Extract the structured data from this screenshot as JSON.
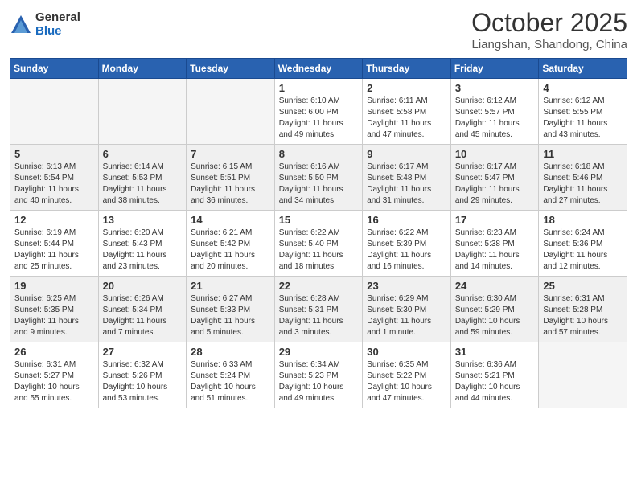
{
  "header": {
    "logo_general": "General",
    "logo_blue": "Blue",
    "month_title": "October 2025",
    "location": "Liangshan, Shandong, China"
  },
  "days_of_week": [
    "Sunday",
    "Monday",
    "Tuesday",
    "Wednesday",
    "Thursday",
    "Friday",
    "Saturday"
  ],
  "weeks": [
    {
      "shade": false,
      "days": [
        {
          "num": "",
          "info": ""
        },
        {
          "num": "",
          "info": ""
        },
        {
          "num": "",
          "info": ""
        },
        {
          "num": "1",
          "info": "Sunrise: 6:10 AM\nSunset: 6:00 PM\nDaylight: 11 hours\nand 49 minutes."
        },
        {
          "num": "2",
          "info": "Sunrise: 6:11 AM\nSunset: 5:58 PM\nDaylight: 11 hours\nand 47 minutes."
        },
        {
          "num": "3",
          "info": "Sunrise: 6:12 AM\nSunset: 5:57 PM\nDaylight: 11 hours\nand 45 minutes."
        },
        {
          "num": "4",
          "info": "Sunrise: 6:12 AM\nSunset: 5:55 PM\nDaylight: 11 hours\nand 43 minutes."
        }
      ]
    },
    {
      "shade": true,
      "days": [
        {
          "num": "5",
          "info": "Sunrise: 6:13 AM\nSunset: 5:54 PM\nDaylight: 11 hours\nand 40 minutes."
        },
        {
          "num": "6",
          "info": "Sunrise: 6:14 AM\nSunset: 5:53 PM\nDaylight: 11 hours\nand 38 minutes."
        },
        {
          "num": "7",
          "info": "Sunrise: 6:15 AM\nSunset: 5:51 PM\nDaylight: 11 hours\nand 36 minutes."
        },
        {
          "num": "8",
          "info": "Sunrise: 6:16 AM\nSunset: 5:50 PM\nDaylight: 11 hours\nand 34 minutes."
        },
        {
          "num": "9",
          "info": "Sunrise: 6:17 AM\nSunset: 5:48 PM\nDaylight: 11 hours\nand 31 minutes."
        },
        {
          "num": "10",
          "info": "Sunrise: 6:17 AM\nSunset: 5:47 PM\nDaylight: 11 hours\nand 29 minutes."
        },
        {
          "num": "11",
          "info": "Sunrise: 6:18 AM\nSunset: 5:46 PM\nDaylight: 11 hours\nand 27 minutes."
        }
      ]
    },
    {
      "shade": false,
      "days": [
        {
          "num": "12",
          "info": "Sunrise: 6:19 AM\nSunset: 5:44 PM\nDaylight: 11 hours\nand 25 minutes."
        },
        {
          "num": "13",
          "info": "Sunrise: 6:20 AM\nSunset: 5:43 PM\nDaylight: 11 hours\nand 23 minutes."
        },
        {
          "num": "14",
          "info": "Sunrise: 6:21 AM\nSunset: 5:42 PM\nDaylight: 11 hours\nand 20 minutes."
        },
        {
          "num": "15",
          "info": "Sunrise: 6:22 AM\nSunset: 5:40 PM\nDaylight: 11 hours\nand 18 minutes."
        },
        {
          "num": "16",
          "info": "Sunrise: 6:22 AM\nSunset: 5:39 PM\nDaylight: 11 hours\nand 16 minutes."
        },
        {
          "num": "17",
          "info": "Sunrise: 6:23 AM\nSunset: 5:38 PM\nDaylight: 11 hours\nand 14 minutes."
        },
        {
          "num": "18",
          "info": "Sunrise: 6:24 AM\nSunset: 5:36 PM\nDaylight: 11 hours\nand 12 minutes."
        }
      ]
    },
    {
      "shade": true,
      "days": [
        {
          "num": "19",
          "info": "Sunrise: 6:25 AM\nSunset: 5:35 PM\nDaylight: 11 hours\nand 9 minutes."
        },
        {
          "num": "20",
          "info": "Sunrise: 6:26 AM\nSunset: 5:34 PM\nDaylight: 11 hours\nand 7 minutes."
        },
        {
          "num": "21",
          "info": "Sunrise: 6:27 AM\nSunset: 5:33 PM\nDaylight: 11 hours\nand 5 minutes."
        },
        {
          "num": "22",
          "info": "Sunrise: 6:28 AM\nSunset: 5:31 PM\nDaylight: 11 hours\nand 3 minutes."
        },
        {
          "num": "23",
          "info": "Sunrise: 6:29 AM\nSunset: 5:30 PM\nDaylight: 11 hours\nand 1 minute."
        },
        {
          "num": "24",
          "info": "Sunrise: 6:30 AM\nSunset: 5:29 PM\nDaylight: 10 hours\nand 59 minutes."
        },
        {
          "num": "25",
          "info": "Sunrise: 6:31 AM\nSunset: 5:28 PM\nDaylight: 10 hours\nand 57 minutes."
        }
      ]
    },
    {
      "shade": false,
      "days": [
        {
          "num": "26",
          "info": "Sunrise: 6:31 AM\nSunset: 5:27 PM\nDaylight: 10 hours\nand 55 minutes."
        },
        {
          "num": "27",
          "info": "Sunrise: 6:32 AM\nSunset: 5:26 PM\nDaylight: 10 hours\nand 53 minutes."
        },
        {
          "num": "28",
          "info": "Sunrise: 6:33 AM\nSunset: 5:24 PM\nDaylight: 10 hours\nand 51 minutes."
        },
        {
          "num": "29",
          "info": "Sunrise: 6:34 AM\nSunset: 5:23 PM\nDaylight: 10 hours\nand 49 minutes."
        },
        {
          "num": "30",
          "info": "Sunrise: 6:35 AM\nSunset: 5:22 PM\nDaylight: 10 hours\nand 47 minutes."
        },
        {
          "num": "31",
          "info": "Sunrise: 6:36 AM\nSunset: 5:21 PM\nDaylight: 10 hours\nand 44 minutes."
        },
        {
          "num": "",
          "info": ""
        }
      ]
    }
  ]
}
